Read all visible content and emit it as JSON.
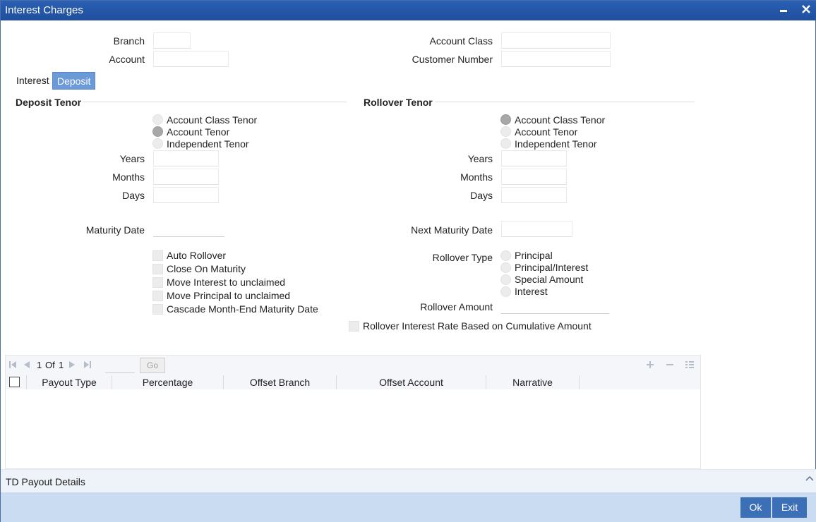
{
  "window": {
    "title": "Interest Charges",
    "minimize_icon": "minimize-icon",
    "close_icon": "close-icon"
  },
  "header": {
    "branch_label": "Branch",
    "branch_value": "",
    "account_label": "Account",
    "account_value": "",
    "account_class_label": "Account Class",
    "account_class_value": "",
    "customer_number_label": "Customer Number",
    "customer_number_value": ""
  },
  "tabs": [
    {
      "label": "Interest",
      "active": false
    },
    {
      "label": "Deposit",
      "active": true
    }
  ],
  "deposit_tenor": {
    "heading": "Deposit Tenor",
    "options": [
      "Account Class Tenor",
      "Account Tenor",
      "Independent Tenor"
    ],
    "selected": "Account Tenor",
    "years_label": "Years",
    "years_value": "",
    "months_label": "Months",
    "months_value": "",
    "days_label": "Days",
    "days_value": "",
    "maturity_date_label": "Maturity Date",
    "maturity_date_value": ""
  },
  "rollover_tenor": {
    "heading": "Rollover Tenor",
    "options": [
      "Account Class Tenor",
      "Account Tenor",
      "Independent Tenor"
    ],
    "selected": "Account Class Tenor",
    "years_label": "Years",
    "years_value": "",
    "months_label": "Months",
    "months_value": "",
    "days_label": "Days",
    "days_value": "",
    "next_maturity_date_label": "Next Maturity Date",
    "next_maturity_date_value": ""
  },
  "checkboxes": [
    {
      "label": "Auto Rollover",
      "checked": false
    },
    {
      "label": "Close On Maturity",
      "checked": false
    },
    {
      "label": "Move Interest to unclaimed",
      "checked": false
    },
    {
      "label": "Move Principal to unclaimed",
      "checked": false
    },
    {
      "label": "Cascade Month-End Maturity Date",
      "checked": false
    }
  ],
  "rollover_type": {
    "label": "Rollover Type",
    "options": [
      "Principal",
      "Principal/Interest",
      "Special Amount",
      "Interest"
    ],
    "selected": ""
  },
  "rollover_amount": {
    "label": "Rollover Amount",
    "value": ""
  },
  "cumulative_check": {
    "label": "Rollover Interest Rate Based on Cumulative Amount",
    "checked": false
  },
  "grid": {
    "pager": {
      "current": "1",
      "of_label": "Of",
      "total": "1",
      "go_label": "Go",
      "page_input": ""
    },
    "columns": [
      "Payout Type",
      "Percentage",
      "Offset Branch",
      "Offset Account",
      "Narrative"
    ],
    "rows": []
  },
  "footer": {
    "section_label": "TD Payout Details"
  },
  "buttons": {
    "ok": "Ok",
    "exit": "Exit"
  }
}
